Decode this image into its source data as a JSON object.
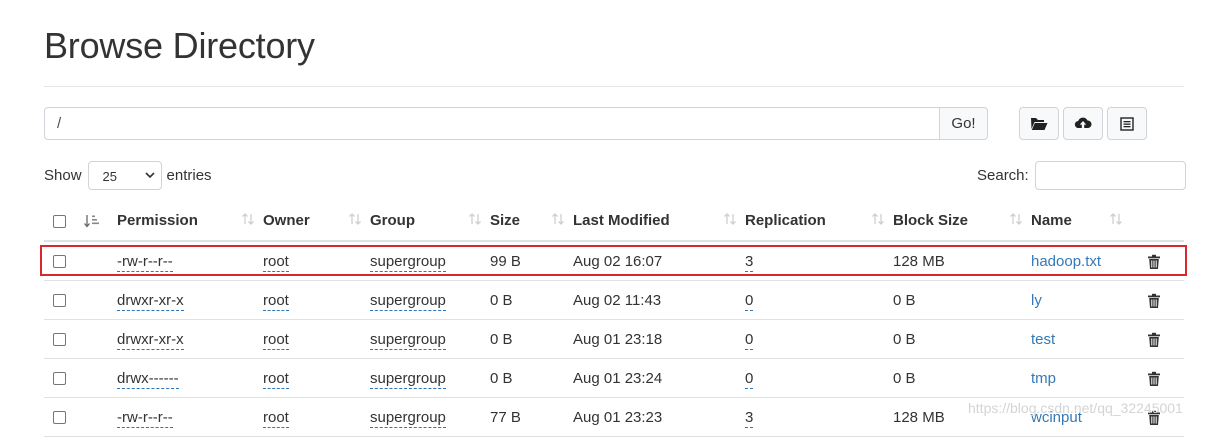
{
  "page": {
    "title": "Browse Directory"
  },
  "path_bar": {
    "value": "/",
    "go_label": "Go!"
  },
  "toolbar": {
    "create_dir_icon": "folder-open-icon",
    "upload_icon": "cloud-upload-icon",
    "cut_paste_icon": "list-icon"
  },
  "controls": {
    "show_label": "Show",
    "page_size": "25",
    "entries_label": "entries",
    "search_label": "Search:",
    "search_value": ""
  },
  "table": {
    "columns": [
      "Permission",
      "Owner",
      "Group",
      "Size",
      "Last Modified",
      "Replication",
      "Block Size",
      "Name"
    ],
    "rows": [
      {
        "permission": "-rw-r--r--",
        "owner": "root",
        "group": "supergroup",
        "size": "99 B",
        "modified": "Aug 02 16:07",
        "replication": "3",
        "block_size": "128 MB",
        "name": "hadoop.txt"
      },
      {
        "permission": "drwxr-xr-x",
        "owner": "root",
        "group": "supergroup",
        "size": "0 B",
        "modified": "Aug 02 11:43",
        "replication": "0",
        "block_size": "0 B",
        "name": "ly"
      },
      {
        "permission": "drwxr-xr-x",
        "owner": "root",
        "group": "supergroup",
        "size": "0 B",
        "modified": "Aug 01 23:18",
        "replication": "0",
        "block_size": "0 B",
        "name": "test"
      },
      {
        "permission": "drwx------",
        "owner": "root",
        "group": "supergroup",
        "size": "0 B",
        "modified": "Aug 01 23:24",
        "replication": "0",
        "block_size": "0 B",
        "name": "tmp"
      },
      {
        "permission": "-rw-r--r--",
        "owner": "root",
        "group": "supergroup",
        "size": "77 B",
        "modified": "Aug 01 23:23",
        "replication": "3",
        "block_size": "128 MB",
        "name": "wcinput"
      }
    ],
    "highlighted_row": 0
  },
  "watermark": "https://blog.csdn.net/qq_32245001",
  "colors": {
    "link": "#337ab7",
    "highlight": "#d9272e",
    "dotted_underline": "#2f74b5"
  }
}
